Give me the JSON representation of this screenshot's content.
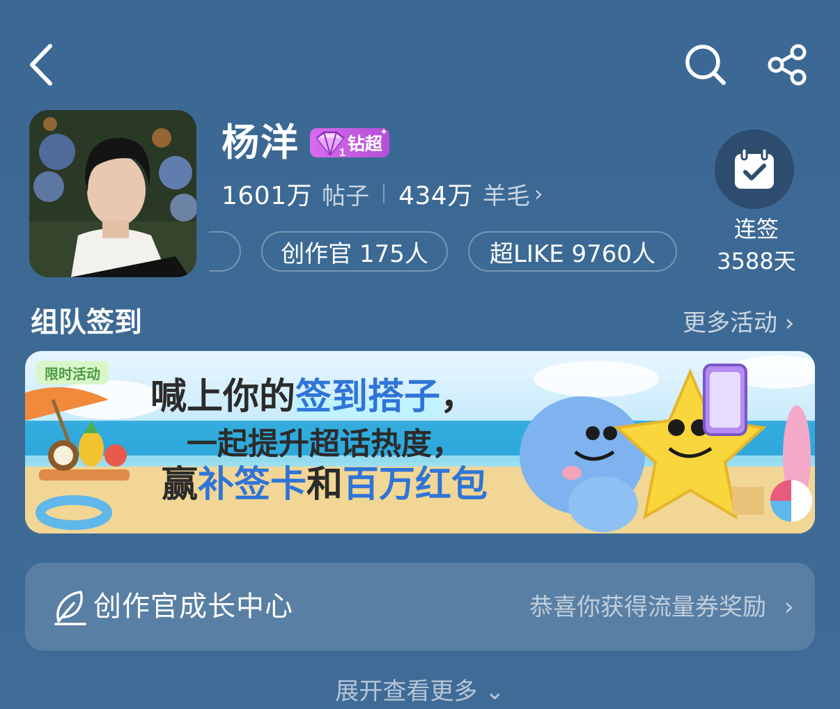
{
  "header": {
    "back_icon": "chevron-left-icon",
    "search_icon": "search-icon",
    "share_icon": "share-icon"
  },
  "profile": {
    "name": "杨洋",
    "badge_label": "钻超",
    "badge_level": "1",
    "badge_colors": [
      "#d96bf0",
      "#b44fd8"
    ],
    "posts_count": "1601万",
    "posts_label": "帖子",
    "fans_count": "434万",
    "fans_label": "羊毛",
    "fans_chevron": "›"
  },
  "pills": {
    "creator": "创作官 175人",
    "superlike": "超LIKE 9760人"
  },
  "checkin": {
    "icon": "calendar-check-icon",
    "label": "连签",
    "days": "3588天"
  },
  "section": {
    "title": "组队签到",
    "more": "更多活动 ›"
  },
  "banner": {
    "tag": "限时活动",
    "line1_pre": "喊上你的",
    "line1_hl": "签到搭子",
    "line1_post": "，",
    "line2": "一起提升超话热度，",
    "line3_a": "赢",
    "line3_b": "补签卡",
    "line3_c": "和",
    "line3_d": "百万红包"
  },
  "creator_center": {
    "icon": "creator-quill-icon",
    "title": "创作官成长中心",
    "message": "恭喜你获得流量券奖励",
    "chevron": "›"
  },
  "expand": {
    "label": "展开查看更多 ⌄"
  }
}
